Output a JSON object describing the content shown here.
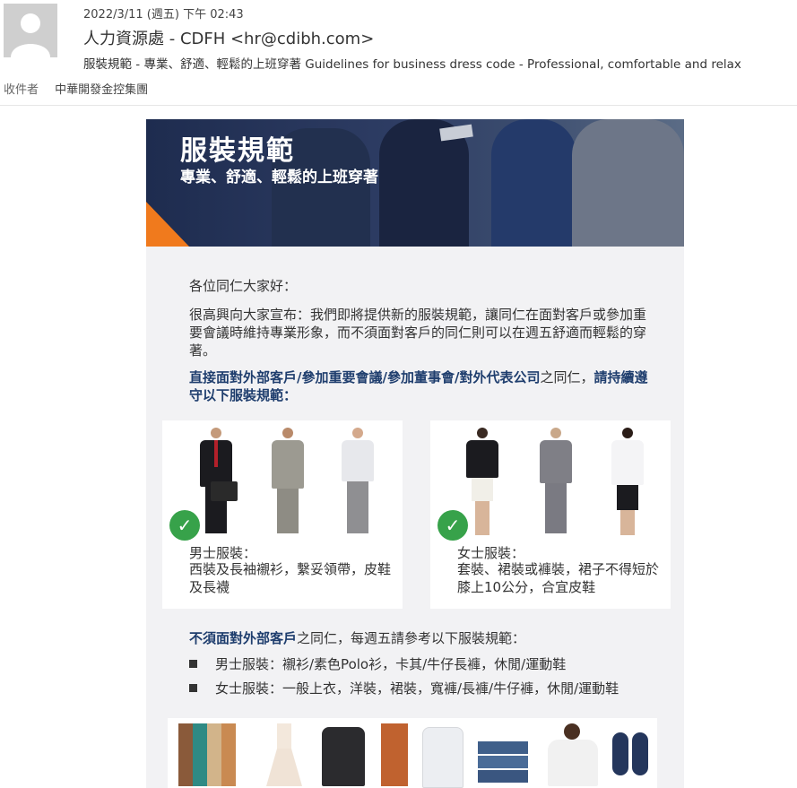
{
  "email": {
    "date": "2022/3/11 (週五) 下午 02:43",
    "sender": "人力資源處 - CDFH <hr@cdibh.com>",
    "subject": "服裝規範 - 專業、舒適、輕鬆的上班穿著  Guidelines for business dress code - Professional, comfortable and relax",
    "recipient_label": "收件者",
    "recipient": "中華開發金控集團"
  },
  "banner": {
    "title": "服裝規範",
    "subtitle": "專業、舒適、輕鬆的上班穿著"
  },
  "body": {
    "greeting": "各位同仁大家好：",
    "intro": "很高興向大家宣布：我們即將提供新的服裝規範，讓同仁在面對客戶或參加重要會議時維持專業形象，而不須面對客戶的同仁則可以在週五舒適而輕鬆的穿著。",
    "instruction1_bold": "直接面對外部客戶/參加重要會議/參加董事會/對外代表公司",
    "instruction1_rest": "之同仁，",
    "instruction1_bold2": "請持續遵守以下服裝規範：",
    "men_label": "男士服裝：",
    "men_desc": "西裝及長袖襯衫，繫妥領帶，皮鞋及長襪",
    "women_label": "女士服裝：",
    "women_desc": "套裝、裙裝或褲裝，裙子不得短於膝上10公分，合宜皮鞋",
    "instruction2_bold": "不須面對外部客戶",
    "instruction2_rest": "之同仁，每週五請參考以下服裝規範：",
    "bullets": [
      "男士服裝：襯衫/素色Polo衫，卡其/牛仔長褲，休閒/運動鞋",
      "女士服裝：一般上衣，洋裝，裙裝，寬褲/長褲/牛仔褲，休閒/運動鞋"
    ]
  },
  "colors": {
    "accent_orange": "#f07a1d",
    "heading_navy": "#1f3e6e",
    "check_green": "#37a24a"
  }
}
